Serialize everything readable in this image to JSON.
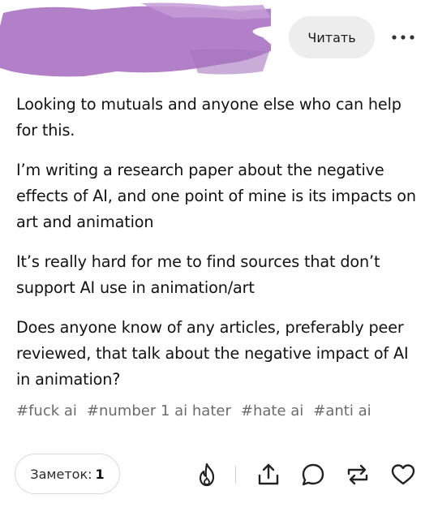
{
  "header": {
    "follow_label": "Читать",
    "more_icon": "more-horizontal-icon",
    "redaction_color": "#b27fc9"
  },
  "post": {
    "paragraphs": [
      "Looking to mutuals and anyone else who can help for this.",
      "I’m writing a research paper about the negative effects of AI, and one point of mine is its impacts on art and animation",
      "It’s really hard for me to find sources that don’t support AI use in animation/art",
      "Does anyone know of any articles, preferably peer reviewed, that talk about the negative impact of AI in animation?"
    ],
    "tags": [
      "#fuck ai",
      "#number 1 ai hater",
      "#hate ai",
      "#anti ai"
    ]
  },
  "footer": {
    "notes_label": "Заметок:",
    "notes_count": "1",
    "icons": [
      "blaze-icon",
      "share-icon",
      "reply-icon",
      "reblog-icon",
      "like-icon"
    ]
  }
}
